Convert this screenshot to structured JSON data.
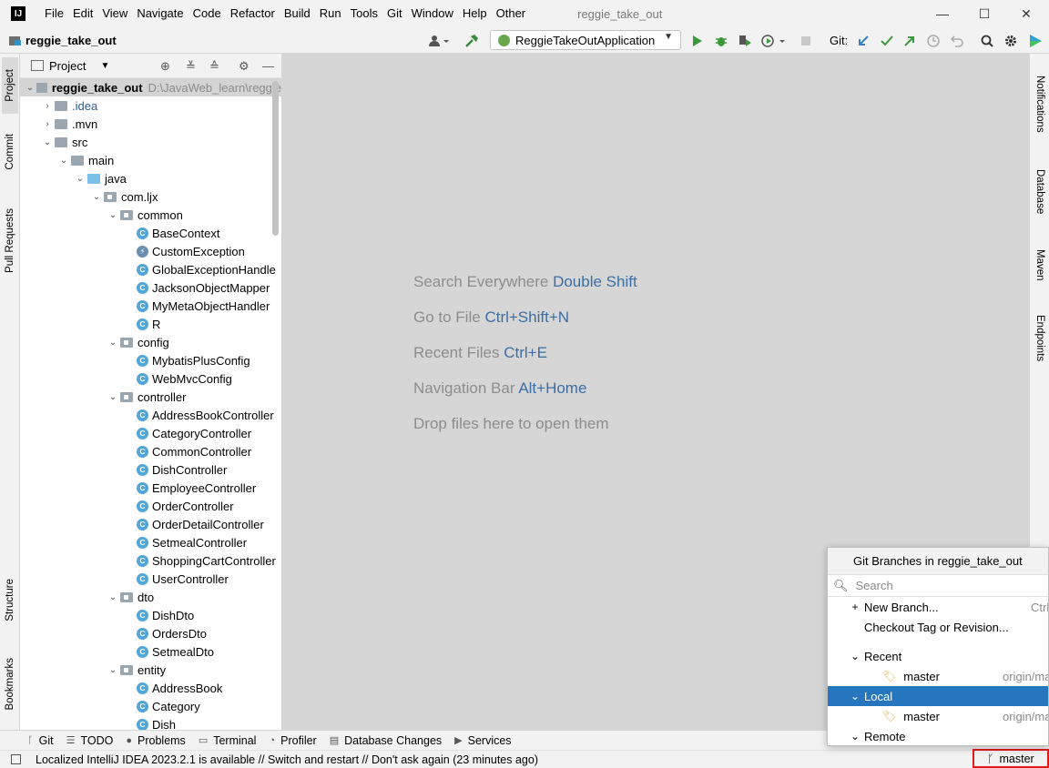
{
  "window": {
    "title": "reggie_take_out",
    "logo": "IJ",
    "menu": [
      "File",
      "Edit",
      "View",
      "Navigate",
      "Code",
      "Refactor",
      "Build",
      "Run",
      "Tools",
      "Git",
      "Window",
      "Help",
      "Other"
    ],
    "controls": {
      "minimize": "—",
      "maximize": "☐",
      "close": "✕"
    }
  },
  "navbar": {
    "project": "reggie_take_out",
    "run_config": "ReggieTakeOutApplication",
    "git_label": "Git:"
  },
  "left_stripe": {
    "tabs": [
      "Project",
      "Commit",
      "Pull Requests",
      "Structure",
      "Bookmarks"
    ]
  },
  "right_stripe": {
    "tabs": [
      "Notifications",
      "Database",
      "Maven",
      "Endpoints"
    ]
  },
  "project_panel": {
    "header": "Project",
    "root_name": "reggie_take_out",
    "root_path": "D:\\JavaWeb_learn\\reggie",
    "tree": [
      {
        "label": ".idea",
        "type": "folder"
      },
      {
        "label": ".mvn",
        "type": "folder"
      },
      {
        "label": "src",
        "type": "folder"
      },
      {
        "label": "main",
        "type": "folder"
      },
      {
        "label": "java",
        "type": "folder"
      },
      {
        "label": "com.ljx",
        "type": "package"
      },
      {
        "label": "common",
        "type": "package"
      },
      {
        "label": "BaseContext",
        "type": "class"
      },
      {
        "label": "CustomException",
        "type": "exception"
      },
      {
        "label": "GlobalExceptionHandle",
        "type": "class"
      },
      {
        "label": "JacksonObjectMapper",
        "type": "class"
      },
      {
        "label": "MyMetaObjectHandler",
        "type": "class"
      },
      {
        "label": "R",
        "type": "class"
      },
      {
        "label": "config",
        "type": "package"
      },
      {
        "label": "MybatisPlusConfig",
        "type": "class"
      },
      {
        "label": "WebMvcConfig",
        "type": "class"
      },
      {
        "label": "controller",
        "type": "package"
      },
      {
        "label": "AddressBookController",
        "type": "class"
      },
      {
        "label": "CategoryController",
        "type": "class"
      },
      {
        "label": "CommonController",
        "type": "class"
      },
      {
        "label": "DishController",
        "type": "class"
      },
      {
        "label": "EmployeeController",
        "type": "class"
      },
      {
        "label": "OrderController",
        "type": "class"
      },
      {
        "label": "OrderDetailController",
        "type": "class"
      },
      {
        "label": "SetmealController",
        "type": "class"
      },
      {
        "label": "ShoppingCartController",
        "type": "class"
      },
      {
        "label": "UserController",
        "type": "class"
      },
      {
        "label": "dto",
        "type": "package"
      },
      {
        "label": "DishDto",
        "type": "class"
      },
      {
        "label": "OrdersDto",
        "type": "class"
      },
      {
        "label": "SetmealDto",
        "type": "class"
      },
      {
        "label": "entity",
        "type": "package"
      },
      {
        "label": "AddressBook",
        "type": "class"
      },
      {
        "label": "Category",
        "type": "class"
      },
      {
        "label": "Dish",
        "type": "class"
      }
    ]
  },
  "editor": {
    "hints": [
      {
        "text": "Search Everywhere",
        "key": "Double Shift"
      },
      {
        "text": "Go to File",
        "key": "Ctrl+Shift+N"
      },
      {
        "text": "Recent Files",
        "key": "Ctrl+E"
      },
      {
        "text": "Navigation Bar",
        "key": "Alt+Home"
      },
      {
        "text": "Drop files here to open them",
        "key": ""
      }
    ]
  },
  "bottom_tabs": [
    "Git",
    "TODO",
    "Problems",
    "Terminal",
    "Profiler",
    "Database Changes",
    "Services"
  ],
  "status": {
    "message": "Localized IntelliJ IDEA 2023.2.1 is available // Switch and restart // Don't ask again (23 minutes ago)",
    "branch": "master"
  },
  "git_popup": {
    "title": "Git Branches in reggie_take_out",
    "search_placeholder": "Search",
    "new_branch": "New Branch...",
    "new_branch_shortcut": "Ctrl",
    "checkout": "Checkout Tag or Revision...",
    "recent_label": "Recent",
    "recent_branch": "master",
    "recent_remote": "origin/ma",
    "local_label": "Local",
    "local_branch": "master",
    "local_remote": "origin/ma",
    "remote_label": "Remote"
  },
  "colors": {
    "editor_bg": "#d6d6d6",
    "selection": "#2675bf",
    "highlight_border": "#e01b1b",
    "link_key": "#3c6ea3"
  }
}
